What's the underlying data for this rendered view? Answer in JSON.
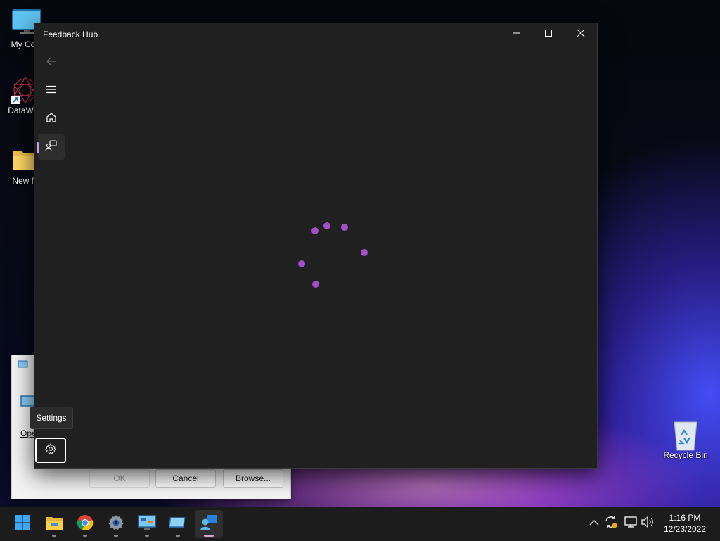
{
  "desktop": {
    "icons": [
      {
        "label": "My Com"
      },
      {
        "label": "DataWag"
      },
      {
        "label": "New fo"
      },
      {
        "label": "Recycle Bin"
      }
    ]
  },
  "dialog": {
    "open_label": "Ope",
    "ok_label": "OK",
    "cancel_label": "Cancel",
    "browse_label": "Browse..."
  },
  "window": {
    "title": "Feedback Hub",
    "tooltip": "Settings",
    "nav": [
      {
        "icon": "back-arrow-icon"
      },
      {
        "icon": "hamburger-menu-icon"
      },
      {
        "icon": "home-icon"
      },
      {
        "icon": "feedback-icon",
        "selected": true
      }
    ],
    "accent_color": "#a24fc9"
  },
  "taskbar": {
    "apps": [
      {
        "name": "start"
      },
      {
        "name": "file-explorer"
      },
      {
        "name": "chrome"
      },
      {
        "name": "settings"
      },
      {
        "name": "control-panel"
      },
      {
        "name": "remote-desktop"
      },
      {
        "name": "feedback-hub",
        "active": true
      }
    ],
    "clock": {
      "time": "1:16 PM",
      "date": "12/23/2022"
    }
  }
}
